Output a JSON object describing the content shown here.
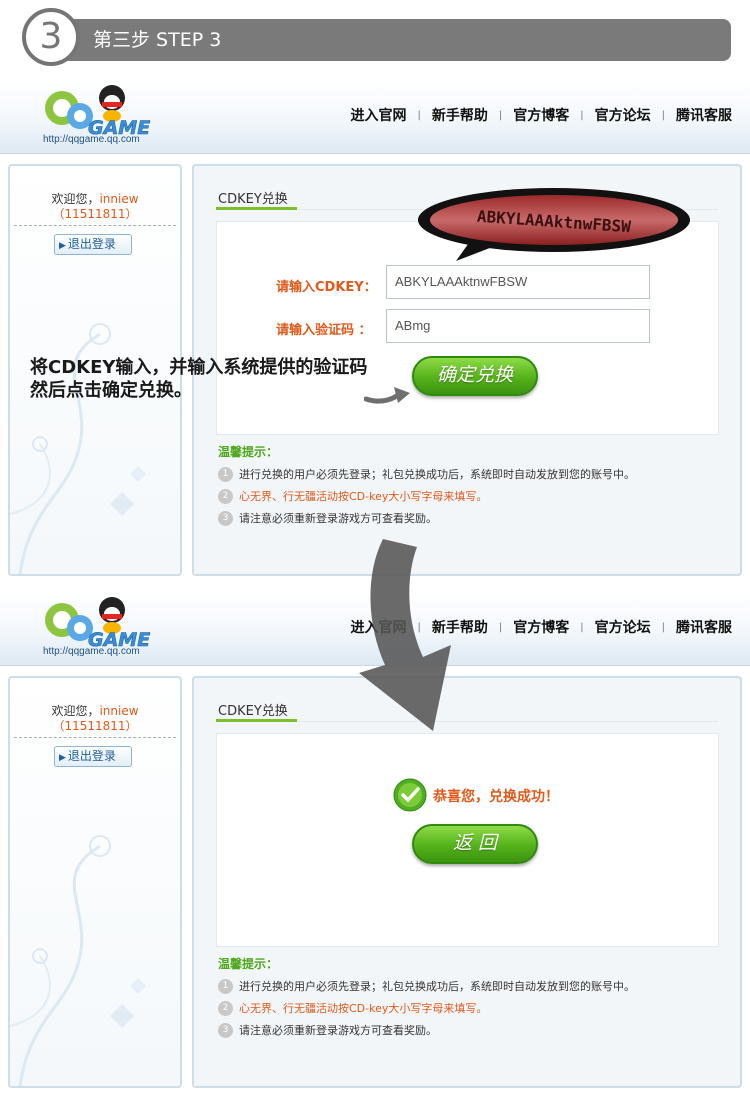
{
  "step": {
    "number": "3",
    "title": "第三步 STEP 3"
  },
  "logo": {
    "url": "http://qqgame.qq.com"
  },
  "nav": [
    "进入官网",
    "新手帮助",
    "官方博客",
    "官方论坛",
    "腾讯客服"
  ],
  "sidebar": {
    "welcome": "欢迎您，",
    "username": "inniew",
    "uid": "（11511811）",
    "logout": "退出登录"
  },
  "panel": {
    "title": "CDKEY兑换"
  },
  "form": {
    "cdkey_label": "请输入CDKEY：",
    "cdkey_value": "ABKYLAAAktnwFBSW",
    "captcha_label": "请输入验证码 ：",
    "captcha_value": "ABmg",
    "submit": "确定兑换",
    "captcha_image_text": "ABKYLAAAktnwFBSW"
  },
  "success": {
    "message": "恭喜您，兑换成功！",
    "back": "返 回"
  },
  "tips": {
    "title": "温馨提示：",
    "items": [
      "进行兑换的用户必须先登录；礼包兑换成功后，系统即时自动发放到您的账号中。",
      "心无界、行无疆活动按CD-key大小写字母来填写。",
      "请注意必须重新登录游戏方可查看奖励。"
    ]
  },
  "annotation": {
    "line1": "将CDKEY输入，并输入系统提供的验证码",
    "line2": "然后点击确定兑换。"
  },
  "colors": {
    "accent_orange": "#e05a1c",
    "button_green": "#54b21a",
    "step_gray": "#7a7a7a"
  }
}
